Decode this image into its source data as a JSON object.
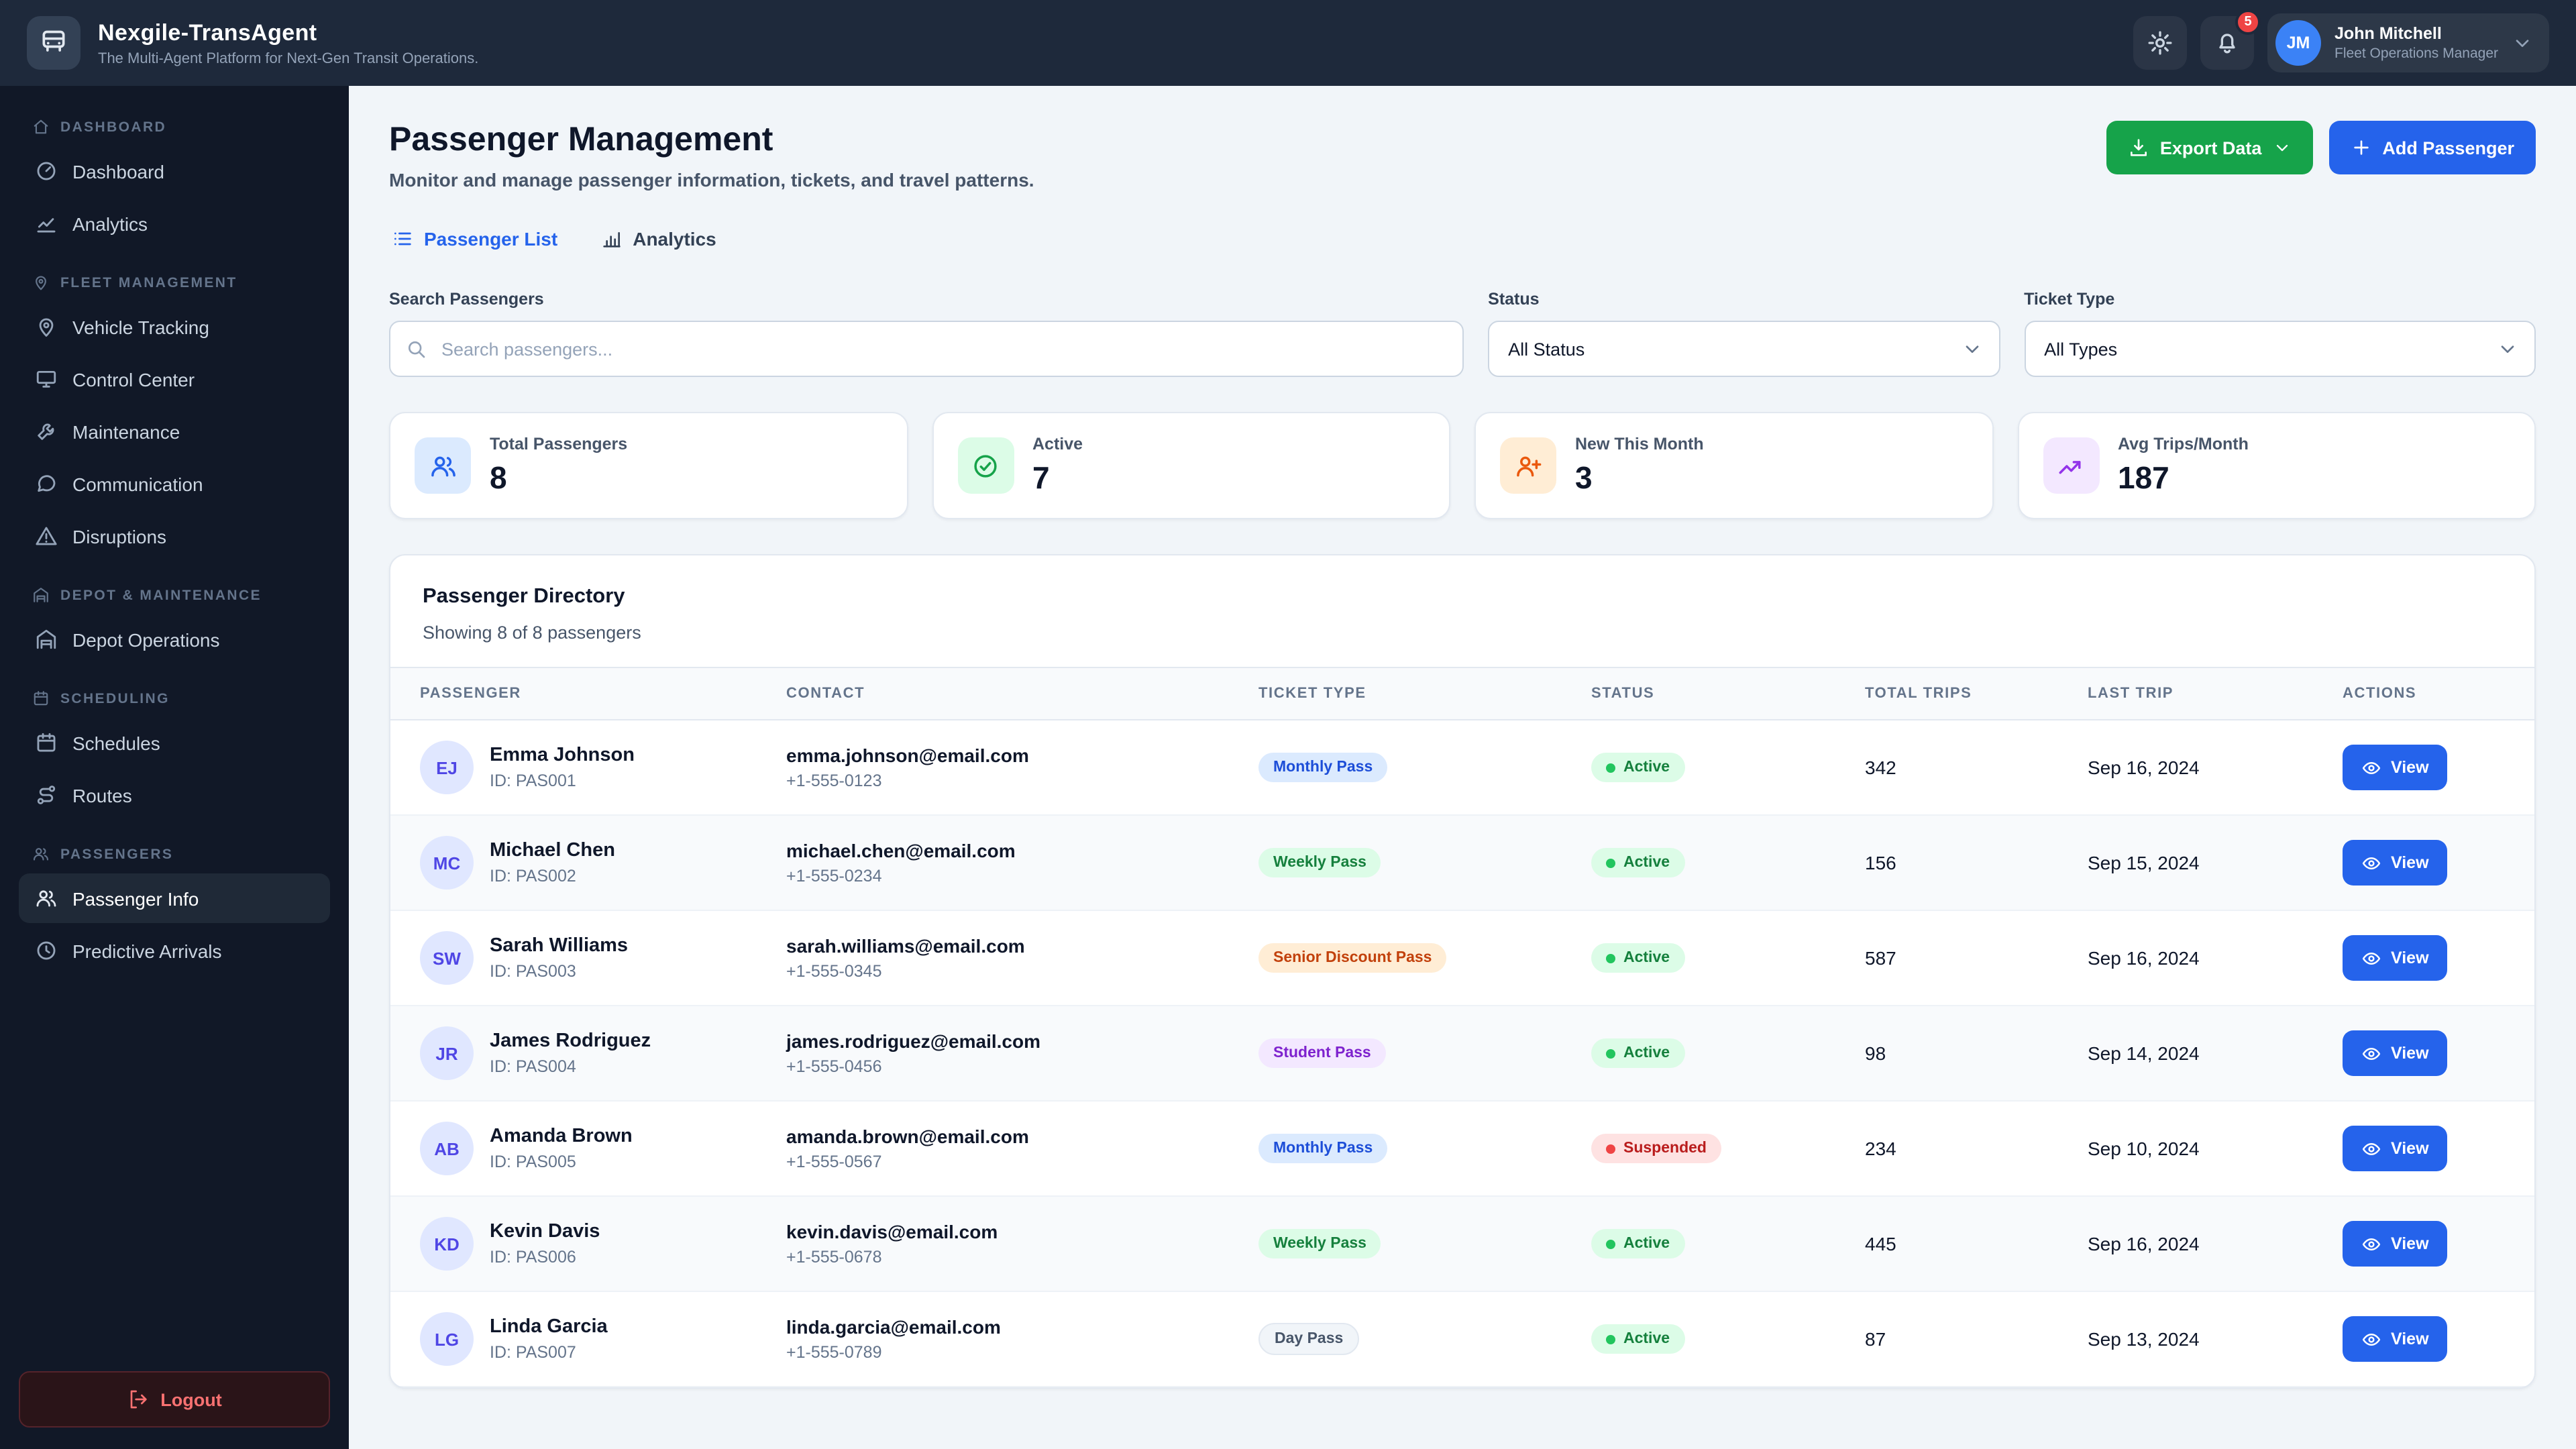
{
  "topbar": {
    "logo_icon": "bus-icon",
    "app_title": "Nexgile-TransAgent",
    "app_subtitle": "The Multi-Agent Platform for Next-Gen Transit Operations.",
    "settings_icon": "gear-icon",
    "notifications": {
      "icon": "bell-icon",
      "count": "5"
    },
    "user": {
      "initials": "JM",
      "name": "John Mitchell",
      "role": "Fleet Operations Manager",
      "chevron_icon": "chevron-down-icon"
    }
  },
  "sidebar": {
    "sections": [
      {
        "label": "DASHBOARD",
        "icon": "home-icon",
        "items": [
          {
            "label": "Dashboard",
            "icon": "gauge-icon",
            "active": false
          },
          {
            "label": "Analytics",
            "icon": "chart-line-icon",
            "active": false
          }
        ]
      },
      {
        "label": "FLEET MANAGEMENT",
        "icon": "map-pin-icon",
        "items": [
          {
            "label": "Vehicle Tracking",
            "icon": "map-pin-icon",
            "active": false
          },
          {
            "label": "Control Center",
            "icon": "monitor-icon",
            "active": false
          },
          {
            "label": "Maintenance",
            "icon": "wrench-icon",
            "active": false
          },
          {
            "label": "Communication",
            "icon": "chat-icon",
            "active": false
          },
          {
            "label": "Disruptions",
            "icon": "warning-icon",
            "active": false
          }
        ]
      },
      {
        "label": "DEPOT & MAINTENANCE",
        "icon": "warehouse-icon",
        "items": [
          {
            "label": "Depot Operations",
            "icon": "warehouse-icon",
            "active": false
          }
        ]
      },
      {
        "label": "SCHEDULING",
        "icon": "calendar-icon",
        "items": [
          {
            "label": "Schedules",
            "icon": "calendar-icon",
            "active": false
          },
          {
            "label": "Routes",
            "icon": "route-icon",
            "active": false
          }
        ]
      },
      {
        "label": "PASSENGERS",
        "icon": "users-icon",
        "items": [
          {
            "label": "Passenger Info",
            "icon": "users-icon",
            "active": true
          },
          {
            "label": "Predictive Arrivals",
            "icon": "clock-icon",
            "active": false
          }
        ]
      }
    ],
    "logout": {
      "label": "Logout",
      "icon": "logout-icon"
    }
  },
  "page": {
    "title": "Passenger Management",
    "subtitle": "Monitor and manage passenger information, tickets, and travel patterns.",
    "export_button": {
      "label": "Export Data",
      "icon": "download-icon",
      "chevron_icon": "chevron-down-icon"
    },
    "add_button": {
      "label": "Add Passenger",
      "icon": "plus-icon"
    },
    "tabs": [
      {
        "label": "Passenger List",
        "icon": "list-icon",
        "active": true
      },
      {
        "label": "Analytics",
        "icon": "chart-bar-icon",
        "active": false
      }
    ]
  },
  "filters": {
    "search_label": "Search Passengers",
    "search_placeholder": "Search passengers...",
    "search_icon": "search-icon",
    "status_label": "Status",
    "status_value": "All Status",
    "ticket_label": "Ticket Type",
    "ticket_value": "All Types"
  },
  "stats": [
    {
      "label": "Total Passengers",
      "value": "8",
      "icon": "users-icon",
      "color": "blue"
    },
    {
      "label": "Active",
      "value": "7",
      "icon": "check-circle-icon",
      "color": "green"
    },
    {
      "label": "New This Month",
      "value": "3",
      "icon": "user-plus-icon",
      "color": "orange"
    },
    {
      "label": "Avg Trips/Month",
      "value": "187",
      "icon": "trend-icon",
      "color": "purple"
    }
  ],
  "directory": {
    "title": "Passenger Directory",
    "subtitle": "Showing 8 of 8 passengers",
    "columns": [
      "PASSENGER",
      "CONTACT",
      "TICKET TYPE",
      "STATUS",
      "TOTAL TRIPS",
      "LAST TRIP",
      "ACTIONS"
    ],
    "view_label": "View",
    "view_icon": "eye-icon",
    "rows": [
      {
        "initials": "EJ",
        "name": "Emma Johnson",
        "id": "ID: PAS001",
        "email": "emma.johnson@email.com",
        "phone": "+1-555-0123",
        "ticket": "Monthly Pass",
        "ticket_color": "blue",
        "status": "Active",
        "status_kind": "active",
        "trips": "342",
        "last_trip": "Sep 16, 2024"
      },
      {
        "initials": "MC",
        "name": "Michael Chen",
        "id": "ID: PAS002",
        "email": "michael.chen@email.com",
        "phone": "+1-555-0234",
        "ticket": "Weekly Pass",
        "ticket_color": "green",
        "status": "Active",
        "status_kind": "active",
        "trips": "156",
        "last_trip": "Sep 15, 2024"
      },
      {
        "initials": "SW",
        "name": "Sarah Williams",
        "id": "ID: PAS003",
        "email": "sarah.williams@email.com",
        "phone": "+1-555-0345",
        "ticket": "Senior Discount Pass",
        "ticket_color": "orange",
        "status": "Active",
        "status_kind": "active",
        "trips": "587",
        "last_trip": "Sep 16, 2024"
      },
      {
        "initials": "JR",
        "name": "James Rodriguez",
        "id": "ID: PAS004",
        "email": "james.rodriguez@email.com",
        "phone": "+1-555-0456",
        "ticket": "Student Pass",
        "ticket_color": "purple",
        "status": "Active",
        "status_kind": "active",
        "trips": "98",
        "last_trip": "Sep 14, 2024"
      },
      {
        "initials": "AB",
        "name": "Amanda Brown",
        "id": "ID: PAS005",
        "email": "amanda.brown@email.com",
        "phone": "+1-555-0567",
        "ticket": "Monthly Pass",
        "ticket_color": "blue",
        "status": "Suspended",
        "status_kind": "suspended",
        "trips": "234",
        "last_trip": "Sep 10, 2024"
      },
      {
        "initials": "KD",
        "name": "Kevin Davis",
        "id": "ID: PAS006",
        "email": "kevin.davis@email.com",
        "phone": "+1-555-0678",
        "ticket": "Weekly Pass",
        "ticket_color": "green",
        "status": "Active",
        "status_kind": "active",
        "trips": "445",
        "last_trip": "Sep 16, 2024"
      },
      {
        "initials": "LG",
        "name": "Linda Garcia",
        "id": "ID: PAS007",
        "email": "linda.garcia@email.com",
        "phone": "+1-555-0789",
        "ticket": "Day Pass",
        "ticket_color": "gray",
        "status": "Active",
        "status_kind": "active",
        "trips": "87",
        "last_trip": "Sep 13, 2024"
      }
    ]
  },
  "colors": {
    "topbar_bg": "#1e293b",
    "sidebar_bg": "#111827",
    "page_bg": "#f1f5f9",
    "accent_blue": "#2563eb",
    "accent_green": "#16a34a",
    "danger_red": "#ef4444"
  }
}
